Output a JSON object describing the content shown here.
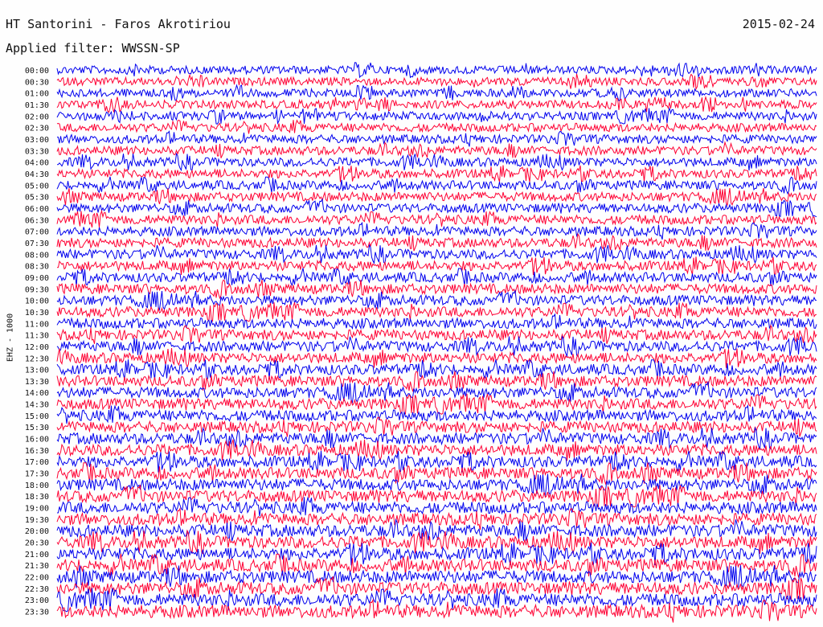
{
  "header": {
    "station": "HT Santorini - Faros Akrotiriou",
    "date": "2015-02-24",
    "filter": "Applied filter: WWSSN-SP"
  },
  "chart_data": {
    "type": "line",
    "title": "HT Santorini - Faros Akrotiriou",
    "date": "2015-02-24",
    "filter_label": "Applied filter: WWSSN-SP",
    "channel_label": "EHZ - 1000",
    "row_labels": [
      "00:00",
      "00:30",
      "01:00",
      "01:30",
      "02:00",
      "02:30",
      "03:00",
      "03:30",
      "04:00",
      "04:30",
      "05:00",
      "05:30",
      "06:00",
      "06:30",
      "07:00",
      "07:30",
      "08:00",
      "08:30",
      "09:00",
      "09:30",
      "10:00",
      "10:30",
      "11:00",
      "11:30",
      "12:00",
      "12:30",
      "13:00",
      "13:30",
      "14:00",
      "14:30",
      "15:00",
      "15:30",
      "16:00",
      "16:30",
      "17:00",
      "17:30",
      "18:00",
      "18:30",
      "19:00",
      "19:30",
      "20:00",
      "20:30",
      "21:00",
      "21:30",
      "22:00",
      "22:30",
      "23:00",
      "23:30"
    ],
    "series_colors": [
      "#0000ee",
      "#ff0033"
    ],
    "grid": false
  }
}
